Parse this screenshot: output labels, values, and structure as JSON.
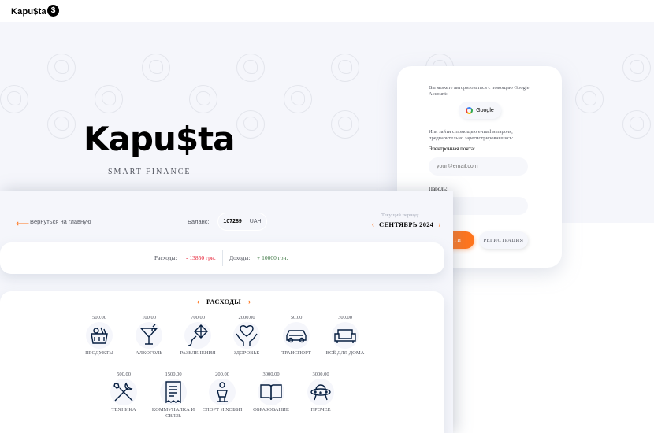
{
  "topbar": {
    "logo": "Kapu$ta",
    "dollar": "$"
  },
  "hero": {
    "title": "Kapu$ta",
    "subtitle": "SMART FINANCE"
  },
  "login": {
    "google_hint": "Вы можете авторизоваться с помощью Google Account:",
    "google_label": "Google",
    "email_hint": "Или зайти с помощью e-mail и пароля, предварительно зарегистрировавшись:",
    "email_label": "Электронная почта:",
    "email_placeholder": "your@email.com",
    "password_label": "Пароль:",
    "login_button": "ВОЙТИ",
    "register_button": "РЕГИСТРАЦИЯ"
  },
  "panel": {
    "back_label": "Вернуться на главную",
    "balance_label": "Баланс:",
    "balance_value": "107289",
    "currency": "UAH",
    "period_label": "Текущий период:",
    "period_value": "СЕНТЯБРЬ 2024"
  },
  "summary": {
    "expenses_label": "Расходы:",
    "expenses_value": "- 13850 грн.",
    "income_label": "Доходы:",
    "income_value": "+ 10000 грн."
  },
  "categories": {
    "title": "РАСХОДЫ",
    "items": [
      {
        "amount": "500.00",
        "name": "ПРОДУКТЫ",
        "icon": "groceries-icon"
      },
      {
        "amount": "100.00",
        "name": "АЛКОГОЛЬ",
        "icon": "cocktail-icon"
      },
      {
        "amount": "700.00",
        "name": "РАЗВЛЕЧЕНИЯ",
        "icon": "kite-icon"
      },
      {
        "amount": "2000.00",
        "name": "ЗДОРОВЬЕ",
        "icon": "heart-hands-icon"
      },
      {
        "amount": "50.00",
        "name": "ТРАНСПОРТ",
        "icon": "car-icon"
      },
      {
        "amount": "300.00",
        "name": "ВСЁ ДЛЯ ДОМА",
        "icon": "sofa-icon"
      },
      {
        "amount": "500.00",
        "name": "ТЕХНИКА",
        "icon": "tools-icon"
      },
      {
        "amount": "1500.00",
        "name": "КОММУНАЛКА И СВЯЗЬ",
        "icon": "receipt-icon"
      },
      {
        "amount": "200.00",
        "name": "СПОРТ И ХОББИ",
        "icon": "sport-icon"
      },
      {
        "amount": "3000.00",
        "name": "ОБРАЗОВАНИЕ",
        "icon": "book-icon"
      },
      {
        "amount": "3000.00",
        "name": "ПРОЧЕЕ",
        "icon": "ufo-icon"
      }
    ]
  },
  "colors": {
    "accent": "#ff751d",
    "expense": "#e7192e",
    "income": "#407946",
    "bg": "#f5f6fb"
  }
}
